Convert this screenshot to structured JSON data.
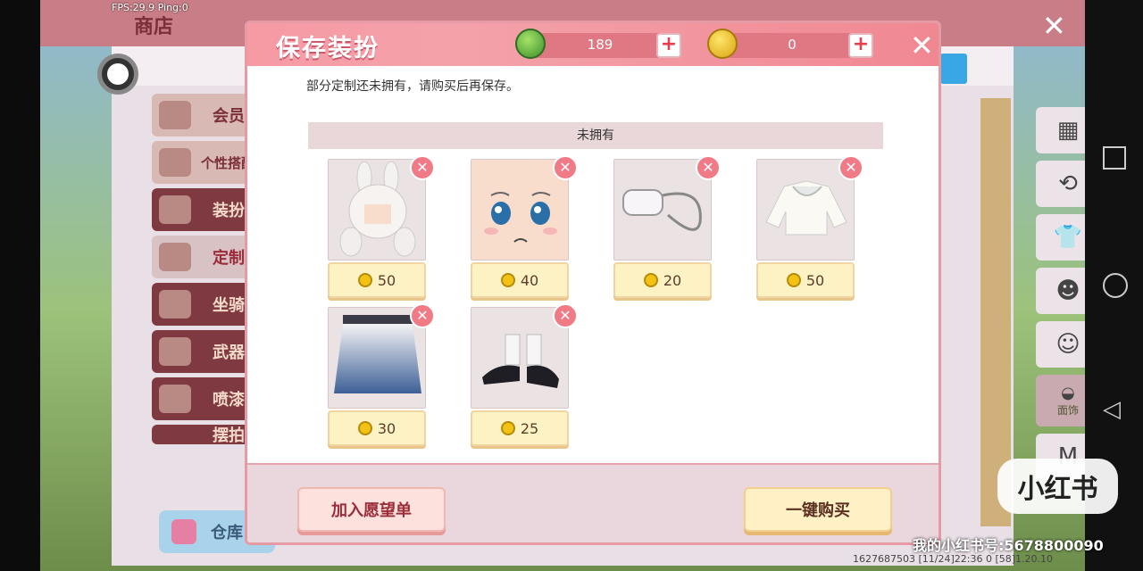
{
  "debug": {
    "fps_text": "FPS:29.9  Ping:0"
  },
  "shop": {
    "title": "商店",
    "categories": [
      {
        "label": "会员"
      },
      {
        "label": "个性搭配"
      },
      {
        "label": "装扮"
      },
      {
        "label": "定制"
      },
      {
        "label": "坐骑"
      },
      {
        "label": "武器"
      },
      {
        "label": "喷漆"
      },
      {
        "label": "摆拍"
      }
    ],
    "warehouse_label": "仓库",
    "right_tools": [
      {
        "icon": "grid-icon"
      },
      {
        "icon": "history-icon"
      },
      {
        "icon": "outfit-icon"
      },
      {
        "icon": "face-icon"
      },
      {
        "icon": "face-icon"
      },
      {
        "icon": "mask-icon",
        "label": "面饰"
      },
      {
        "icon": "shirt-icon"
      }
    ],
    "footer_text": "1627687503  [11/24]22:36 0   [58]1.20.10"
  },
  "modal": {
    "title": "保存装扮",
    "gem_count": "189",
    "coin_count": "0",
    "notice": "部分定制还未拥有，请购买后再保存。",
    "section_label": "未拥有",
    "items": [
      {
        "name": "bunny-ear-hair",
        "price": "50"
      },
      {
        "name": "crying-face",
        "price": "40"
      },
      {
        "name": "face-mask",
        "price": "20"
      },
      {
        "name": "white-sweater",
        "price": "50"
      },
      {
        "name": "blue-skirt",
        "price": "30"
      },
      {
        "name": "black-shoes",
        "price": "25"
      }
    ],
    "wishlist_button": "加入愿望单",
    "buy_button": "一键购买"
  },
  "watermark": {
    "badge": "小红书",
    "account": "我的小红书号:5678800090"
  },
  "colors": {
    "accent": "#f08892",
    "coin": "#f4c214",
    "gem": "#3b8f2a"
  }
}
